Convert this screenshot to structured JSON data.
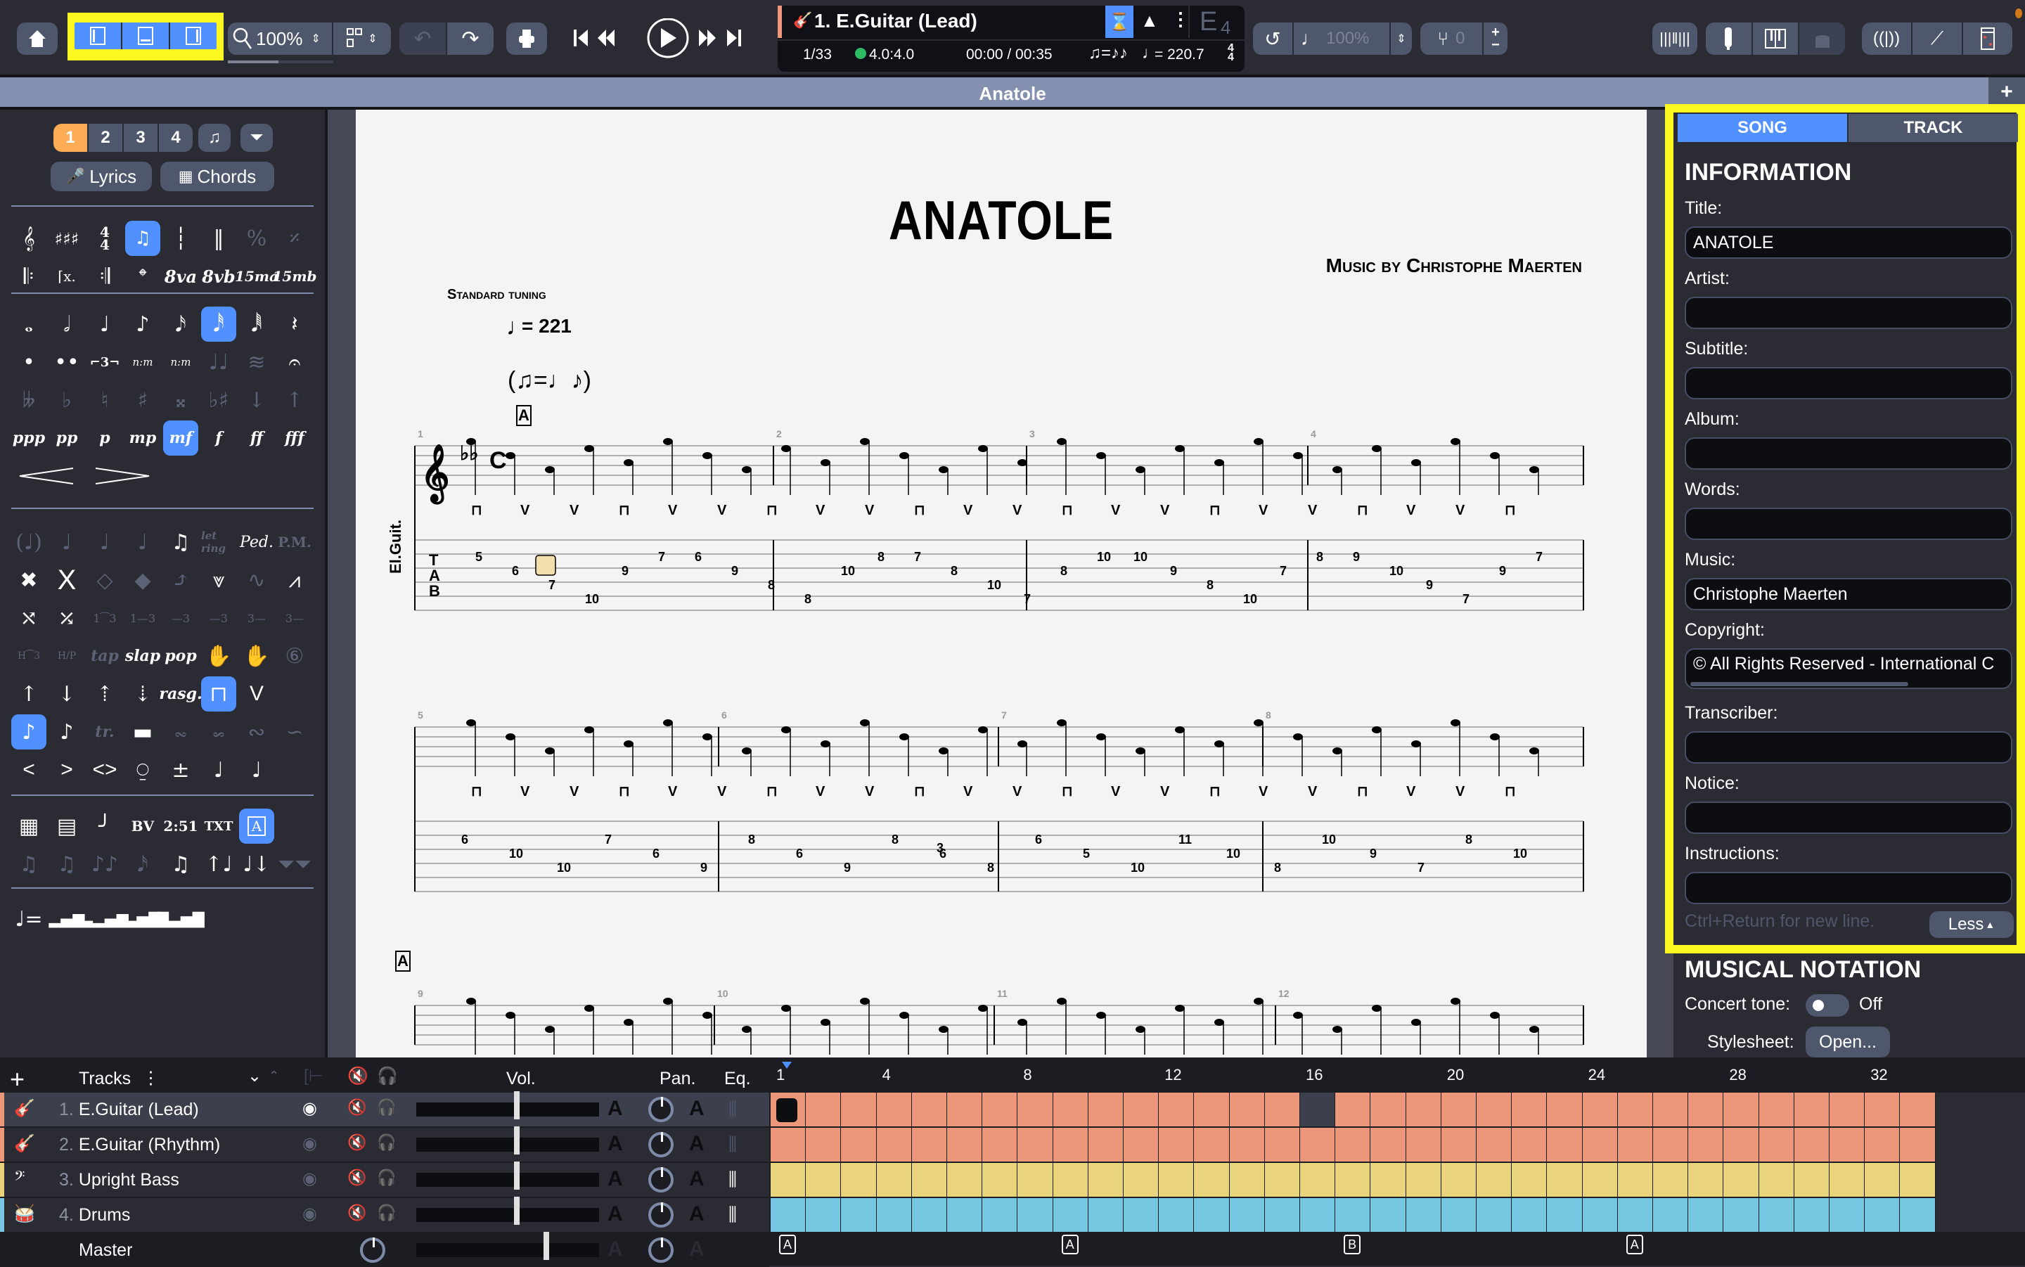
{
  "toolbar": {
    "zoom": "100%",
    "track_name": "1. E.Guitar (Lead)",
    "bar_position": "1/33",
    "time_signature_status": "4.0:4.0",
    "time": "00:00 / 00:35",
    "tempo": "= 220.7",
    "key_display": "E",
    "key_sub": "4",
    "speed": "100%",
    "pitch": "0",
    "accent_color": "#5090ff",
    "highlight_color": "#fdf721"
  },
  "title_bar": {
    "title": "Anatole",
    "add_label": "+"
  },
  "palette": {
    "voices": [
      "1",
      "2",
      "3",
      "4"
    ],
    "lyrics_label": "Lyrics",
    "chords_label": "Chords",
    "ottava": [
      "8va",
      "8vb",
      "15ma",
      "15mb"
    ],
    "dynamics": [
      "ppp",
      "pp",
      "p",
      "mp",
      "mf",
      "f",
      "ff",
      "fff"
    ],
    "selected_dynamic": "mf",
    "techniques": [
      "let ring",
      "Ped.",
      "P.M.",
      "tap",
      "slap",
      "pop",
      "rasg.",
      "tr."
    ],
    "text_tools": [
      "BV",
      "2:51",
      "TXT"
    ]
  },
  "score": {
    "title": "ANATOLE",
    "composer": "Music by Christophe Maerten",
    "tuning": "Standard tuning",
    "tempo": "= 221",
    "section_marker": "A",
    "instrument_label": "El.Guit.",
    "measure_numbers": [
      "1",
      "2",
      "3",
      "4",
      "5",
      "6",
      "7",
      "8",
      "9",
      "10",
      "11",
      "12"
    ],
    "tab_row1": [
      "5",
      "6",
      "7",
      "10",
      "9",
      "7",
      "6",
      "9",
      "8",
      "8",
      "10",
      "8",
      "7",
      "8",
      "10",
      "7",
      "8",
      "10",
      "10",
      "9",
      "8",
      "10",
      "7",
      "8",
      "9",
      "10",
      "9",
      "7",
      "9",
      "7"
    ],
    "tab_row2": [
      "6",
      "10",
      "10",
      "7",
      "6",
      "9",
      "8",
      "6",
      "9",
      "8",
      "6",
      "8",
      "6",
      "5",
      "10",
      "11",
      "10",
      "8",
      "10",
      "9",
      "7",
      "8",
      "10"
    ],
    "triplet": "3"
  },
  "song_panel": {
    "tabs": [
      "SONG",
      "TRACK"
    ],
    "active_tab": "SONG",
    "section_title": "INFORMATION",
    "fields": [
      {
        "label": "Title:",
        "value": "ANATOLE"
      },
      {
        "label": "Artist:",
        "value": ""
      },
      {
        "label": "Subtitle:",
        "value": ""
      },
      {
        "label": "Album:",
        "value": ""
      },
      {
        "label": "Words:",
        "value": ""
      },
      {
        "label": "Music:",
        "value": "Christophe Maerten"
      },
      {
        "label": "Copyright:",
        "value": "© All Rights Reserved - International C"
      },
      {
        "label": "Transcriber:",
        "value": ""
      },
      {
        "label": "Notice:",
        "value": ""
      },
      {
        "label": "Instructions:",
        "value": ""
      }
    ],
    "hint": "Ctrl+Return for new line.",
    "less_label": "Less",
    "notation_title": "MUSICAL NOTATION",
    "concert_tone_label": "Concert tone:",
    "concert_tone_value": "Off",
    "stylesheet_label": "Stylesheet:",
    "stylesheet_button": "Open..."
  },
  "tracks_panel": {
    "header": "Tracks",
    "vol_label": "Vol.",
    "pan_label": "Pan.",
    "eq_label": "Eq.",
    "tracks": [
      {
        "num": "1.",
        "name": "E.Guitar (Lead)",
        "color": "#ec977a",
        "volume": 0.55
      },
      {
        "num": "2.",
        "name": "E.Guitar (Rhythm)",
        "color": "#ec977a",
        "volume": 0.55
      },
      {
        "num": "3.",
        "name": "Upright Bass",
        "color": "#e9d47c",
        "volume": 0.55
      },
      {
        "num": "4.",
        "name": "Drums",
        "color": "#76c8e2",
        "volume": 0.55
      }
    ],
    "master_label": "Master",
    "master_volume": 0.71,
    "ruler": [
      "1",
      "4",
      "8",
      "12",
      "16",
      "20",
      "24",
      "28",
      "32"
    ],
    "bar_count": 33,
    "empty_bar_track1": 16,
    "sections": [
      {
        "bar": 1,
        "label": "A"
      },
      {
        "bar": 9,
        "label": "A"
      },
      {
        "bar": 17,
        "label": "B"
      },
      {
        "bar": 25,
        "label": "A"
      }
    ]
  }
}
